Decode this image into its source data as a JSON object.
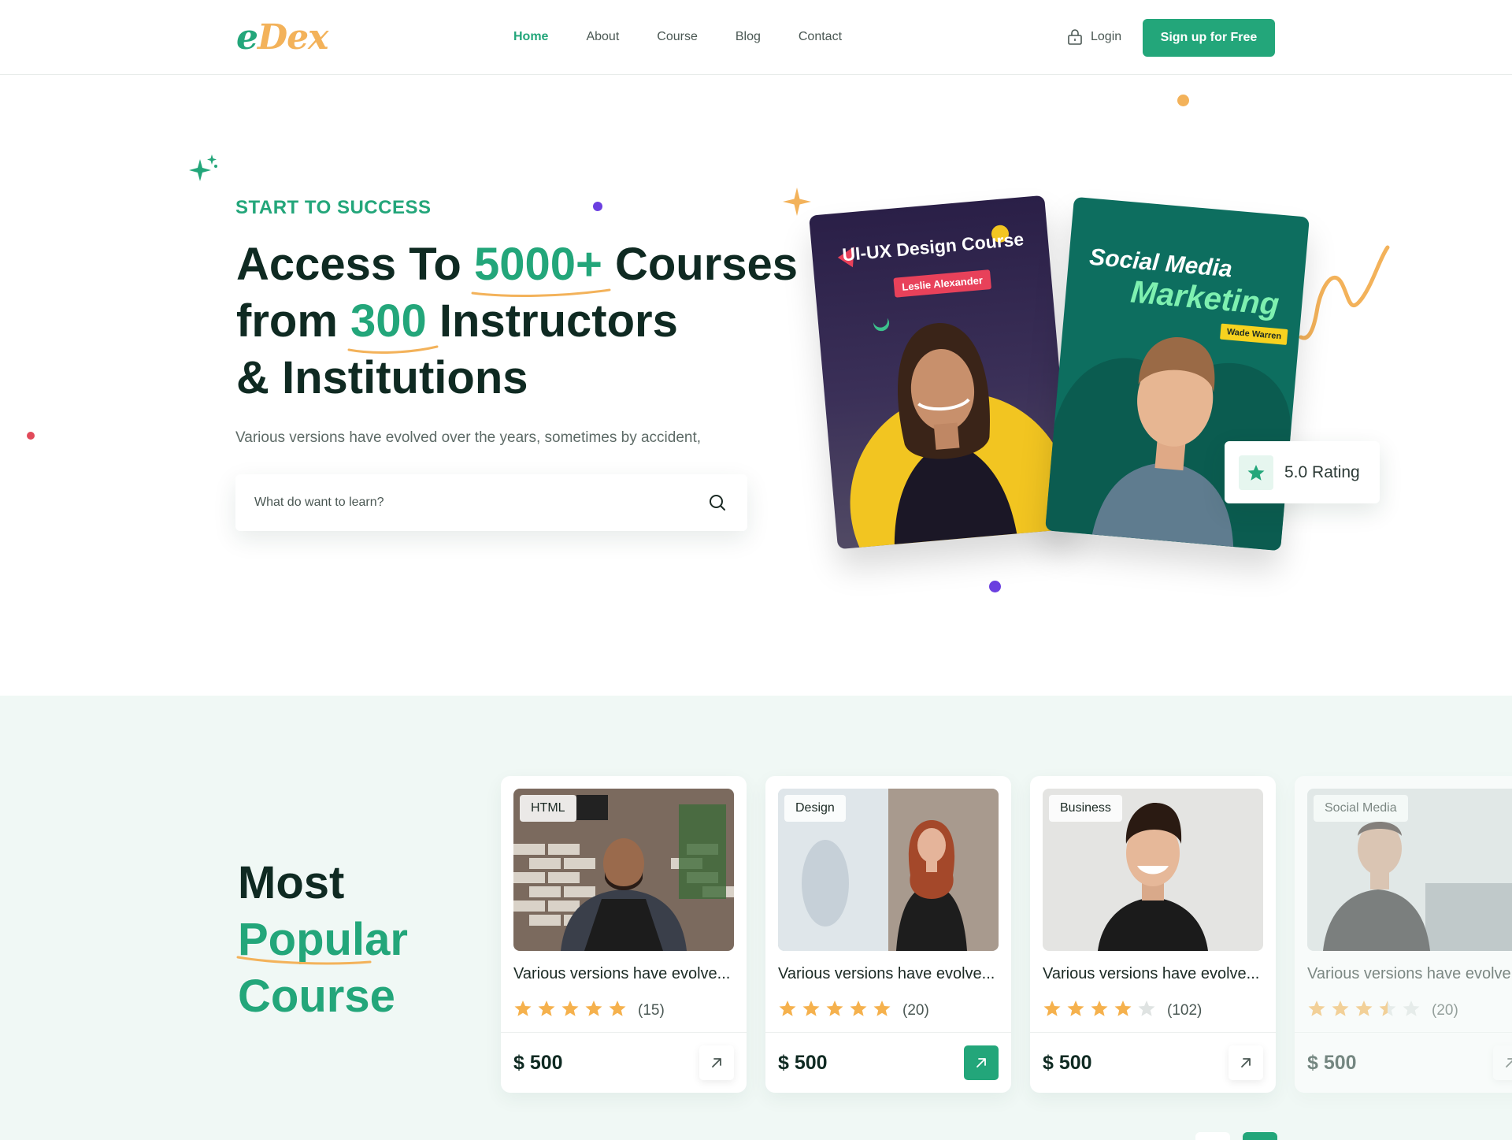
{
  "brand": {
    "logo_part1": "e",
    "logo_part2": "Dex"
  },
  "nav": {
    "items": [
      {
        "label": "Home",
        "active": true
      },
      {
        "label": "About"
      },
      {
        "label": "Course"
      },
      {
        "label": "Blog"
      },
      {
        "label": "Contact"
      }
    ],
    "login_label": "Login",
    "signup_label": "Sign up for Free"
  },
  "hero": {
    "eyebrow": "START TO SUCCESS",
    "title_part1": "Access To ",
    "title_highlight1": "5000+",
    "title_part2": " Courses",
    "title_part3": "from ",
    "title_highlight2": "300",
    "title_part4": " Instructors",
    "title_part5": "& Institutions",
    "subtitle": "Various versions have evolved over the years, sometimes by accident,",
    "search_placeholder": "What do want to learn?",
    "card1": {
      "title": "UI-UX Design Course",
      "instructor": "Leslie Alexander"
    },
    "card2": {
      "title_line1": "Social Media",
      "title_line2": "Marketing",
      "instructor": "Wade Warren"
    },
    "rating_label": "5.0 Rating"
  },
  "popular": {
    "title_line1": "Most",
    "title_line2": "Popular",
    "title_line3": "Course",
    "courses": [
      {
        "category": "HTML",
        "title": "Various versions have evolve...",
        "rating": 5,
        "reviews": "(15)",
        "price": "$ 500",
        "active": false
      },
      {
        "category": "Design",
        "title": "Various versions have evolve...",
        "rating": 5,
        "reviews": "(20)",
        "price": "$ 500",
        "active": true
      },
      {
        "category": "Business",
        "title": "Various versions have evolve...",
        "rating": 4,
        "reviews": "(102)",
        "price": "$ 500",
        "active": false
      },
      {
        "category": "Social Media",
        "title": "Various versions have evolve",
        "rating": 3.5,
        "reviews": "(20)",
        "price": "$ 500",
        "active": false
      }
    ]
  },
  "colors": {
    "primary": "#23a67a",
    "accent_orange": "#f3b25a",
    "star": "#f5b14d",
    "purple_dot": "#6b3fe0",
    "red_dot": "#e14a5a",
    "section_bg": "#f0f8f5"
  }
}
